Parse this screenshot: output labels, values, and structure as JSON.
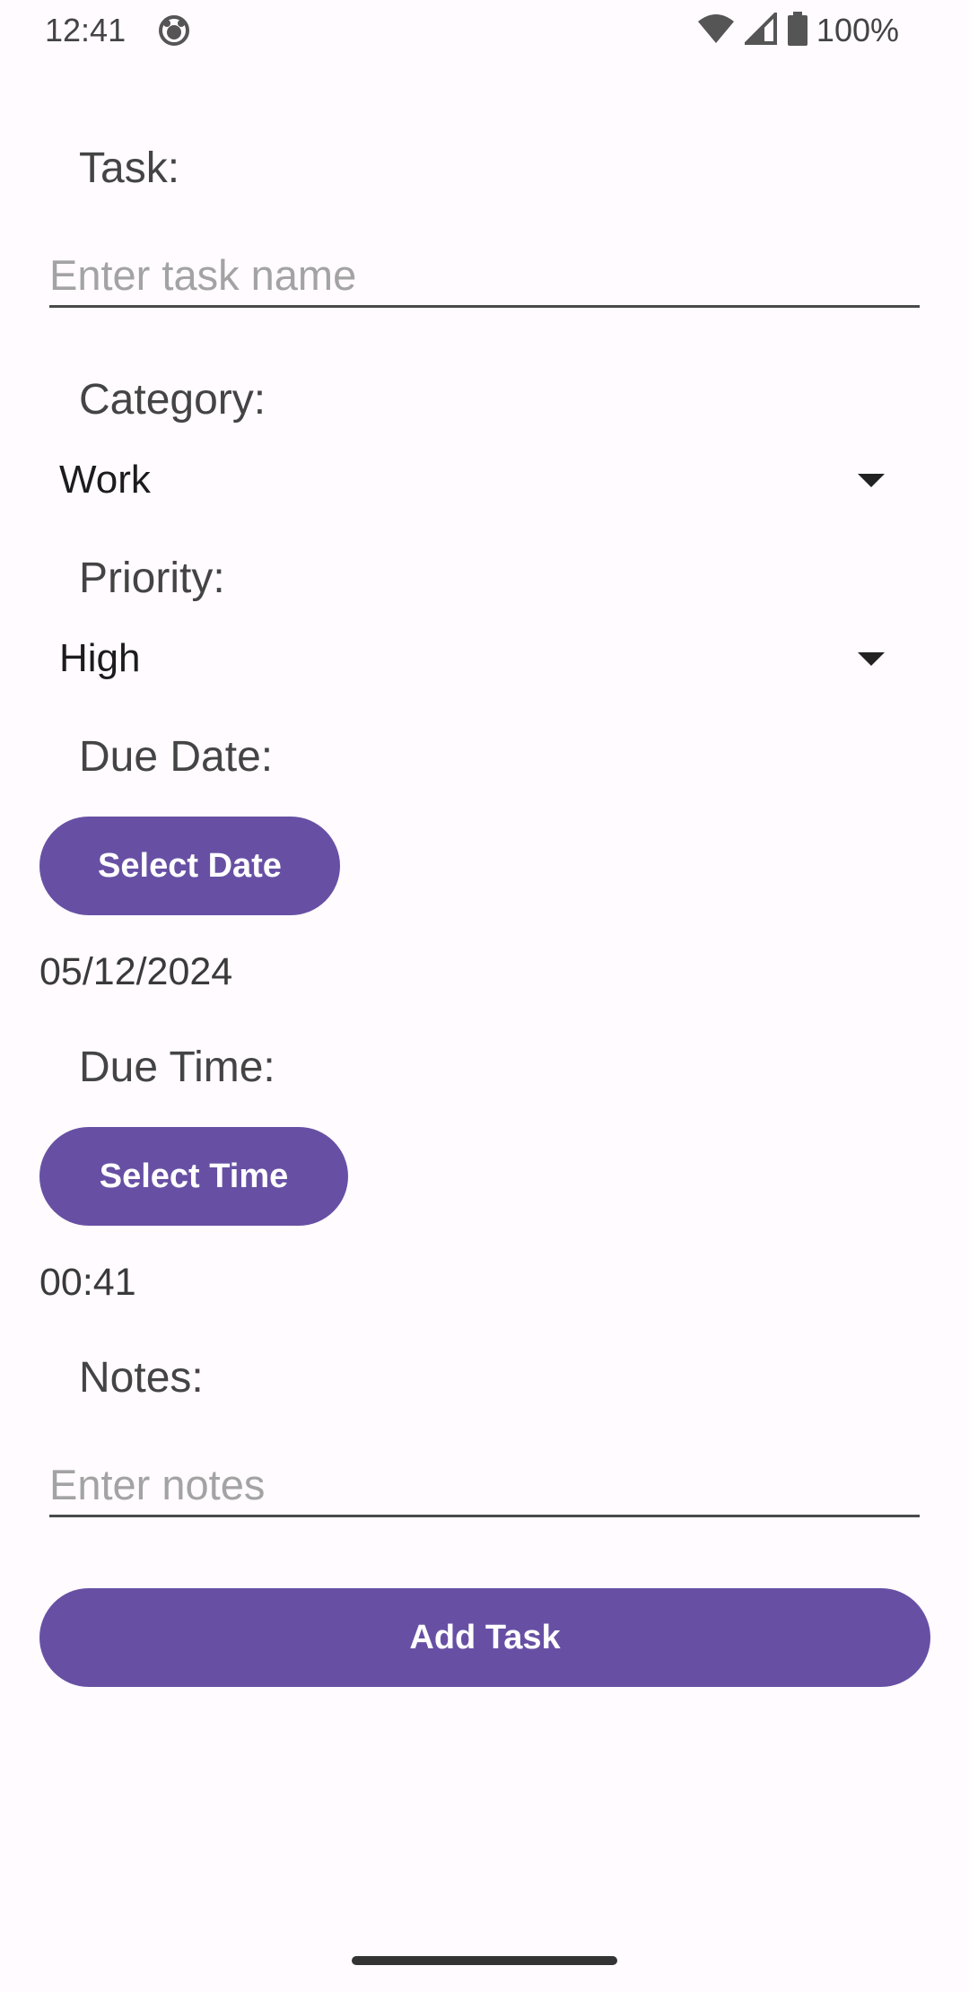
{
  "status_bar": {
    "time": "12:41",
    "battery": "100%",
    "icons": [
      "app-notification-icon",
      "wifi-icon",
      "signal-icon",
      "battery-icon"
    ]
  },
  "form": {
    "task": {
      "label": "Task:",
      "value": "",
      "placeholder": "Enter task name"
    },
    "category": {
      "label": "Category:",
      "selected": "Work"
    },
    "priority": {
      "label": "Priority:",
      "selected": "High"
    },
    "due_date": {
      "label": "Due Date:",
      "button_label": "Select Date",
      "value": "05/12/2024"
    },
    "due_time": {
      "label": "Due Time:",
      "button_label": "Select Time",
      "value": "00:41"
    },
    "notes": {
      "label": "Notes:",
      "value": "",
      "placeholder": "Enter notes"
    },
    "submit_label": "Add Task"
  },
  "colors": {
    "background": "#fffbfe",
    "primary": "#6750a4",
    "on_primary": "#ffffff",
    "label_text": "#444444",
    "placeholder": "#a3a3a3"
  }
}
